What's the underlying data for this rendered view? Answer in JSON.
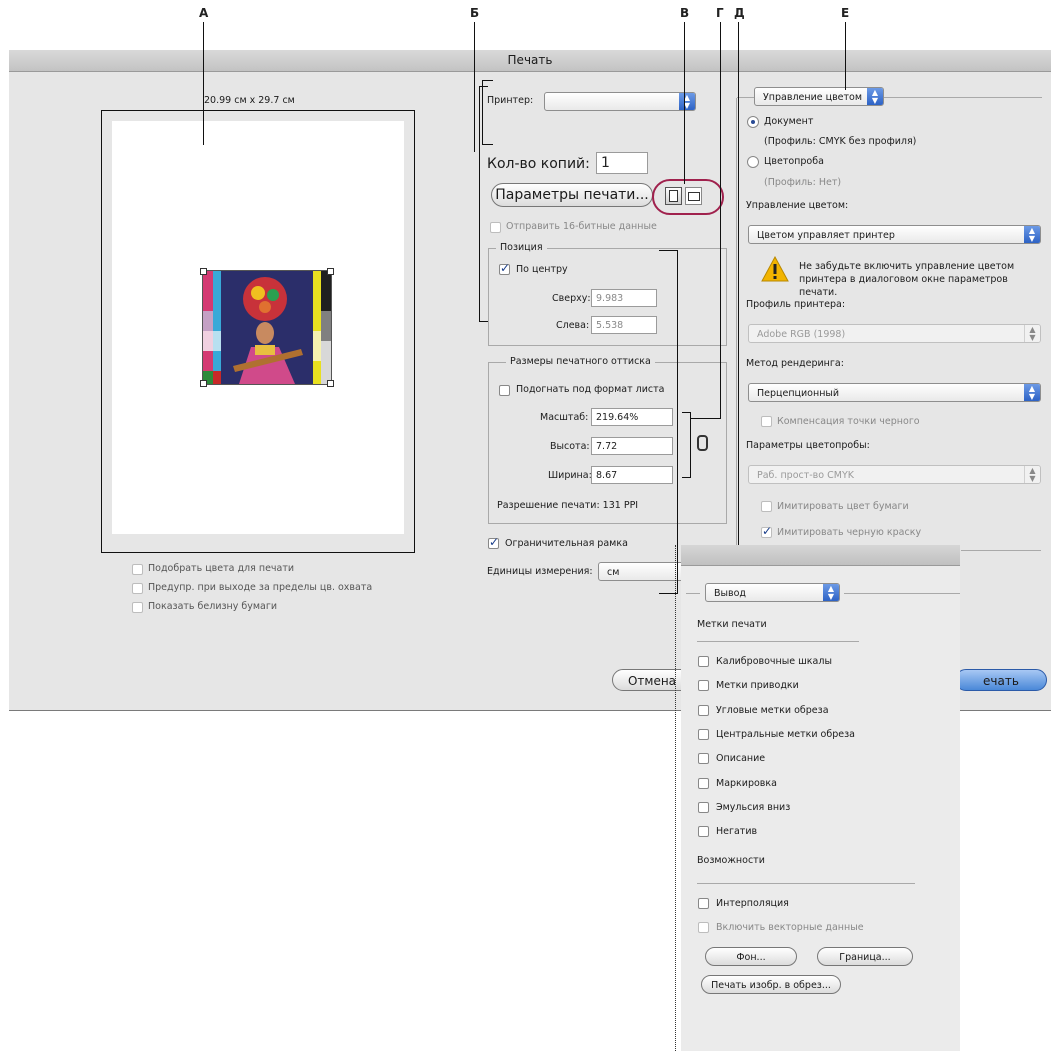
{
  "callouts": [
    "А",
    "Б",
    "В",
    "Г",
    "Д",
    "Е"
  ],
  "dialog": {
    "title": "Печать",
    "preview": {
      "page_size": "20.99 см x 29.7 см",
      "checkboxes": [
        {
          "label": "Подобрать цвета для печати",
          "checked": false
        },
        {
          "label": "Предупр. при выходе за пределы цв. охвата",
          "checked": false
        },
        {
          "label": "Показать белизну бумаги",
          "checked": false
        }
      ]
    },
    "printer": {
      "label": "Принтер:",
      "value": ""
    },
    "copies": {
      "label": "Кол-во копий:",
      "value": "1"
    },
    "print_settings_button": "Параметры печати...",
    "send16bit": {
      "label": "Отправить 16-битные данные",
      "checked": false
    },
    "position": {
      "title": "Позиция",
      "center": {
        "label": "По центру",
        "checked": true
      },
      "top": {
        "label": "Сверху:",
        "value": "9.983"
      },
      "left": {
        "label": "Слева:",
        "value": "5.538"
      }
    },
    "print_size": {
      "title": "Размеры печатного оттиска",
      "fit": {
        "label": "Подогнать под формат листа",
        "checked": false
      },
      "scale": {
        "label": "Масштаб:",
        "value": "219.64%"
      },
      "height": {
        "label": "Высота:",
        "value": "7.72"
      },
      "width": {
        "label": "Ширина:",
        "value": "8.67"
      },
      "resolution": "Разрешение печати: 131 PPI"
    },
    "bounding_box": {
      "label": "Ограничительная рамка",
      "checked": true
    },
    "units": {
      "label": "Единицы измерения:",
      "value": "см"
    },
    "cancel_button": "Отмена",
    "print_button": "ечать",
    "color": {
      "mode_select": "Управление цветом",
      "document": {
        "label": "Документ",
        "profile": "(Профиль: CMYK без профиля)",
        "selected": true
      },
      "proof": {
        "label": "Цветопроба",
        "profile": "(Профиль: Нет)",
        "selected": false
      },
      "handling_label": "Управление цветом:",
      "handling_value": "Цветом управляет принтер",
      "warning": "Не забудьте включить управление цветом принтера в диалоговом окне параметров печати.",
      "printer_profile_label": "Профиль принтера:",
      "printer_profile_value": "Adobe RGB (1998)",
      "render_label": "Метод рендеринга:",
      "render_value": "Перцепционный",
      "bpc": {
        "label": "Компенсация точки черного",
        "checked": false
      },
      "proof_label": "Параметры цветопробы:",
      "proof_value": "Раб. прост-во CMYK",
      "sim_paper": {
        "label": "Имитировать цвет бумаги",
        "checked": false
      },
      "sim_ink": {
        "label": "Имитировать черную краску",
        "checked": true
      }
    }
  },
  "output_panel": {
    "mode_select": "Вывод",
    "marks_title": "Метки печати",
    "marks": [
      {
        "label": "Калибровочные шкалы",
        "checked": false
      },
      {
        "label": "Метки приводки",
        "checked": false
      },
      {
        "label": "Угловые метки обреза",
        "checked": false
      },
      {
        "label": "Центральные метки обреза",
        "checked": false
      },
      {
        "label": "Описание",
        "checked": false
      },
      {
        "label": "Маркировка",
        "checked": false
      },
      {
        "label": "Эмульсия вниз",
        "checked": false
      },
      {
        "label": "Негатив",
        "checked": false
      }
    ],
    "features_title": "Возможности",
    "interpolation": {
      "label": "Интерполяция",
      "checked": false
    },
    "vector": {
      "label": "Включить векторные данные",
      "checked": false
    },
    "background_button": "Фон...",
    "border_button": "Граница...",
    "bleed_button": "Печать изобр. в обрез..."
  },
  "colors": {
    "accent": "#2d62c5",
    "highlight_ring": "#a0214d",
    "warning": "#f2b400"
  }
}
